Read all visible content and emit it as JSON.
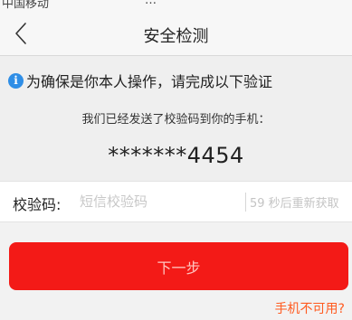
{
  "status_bar": {
    "left_partial": "中国移动",
    "center_partial": "…"
  },
  "header": {
    "title": "安全检测"
  },
  "notice": {
    "instruction": "为确保是你本人操作，请完成以下验证",
    "sent_message": "我们已经发送了校验码到你的手机：",
    "masked_phone": "*******4454"
  },
  "code_form": {
    "label": "校验码:",
    "placeholder": "短信校验码",
    "value": "",
    "resend_text": "59 秒后重新获取"
  },
  "actions": {
    "next_label": "下一步",
    "phone_unavailable_label": "手机不可用?"
  },
  "colors": {
    "button_bg": "#f31a17",
    "link": "#ff5a1f",
    "info_icon": "#2f8ee6"
  }
}
